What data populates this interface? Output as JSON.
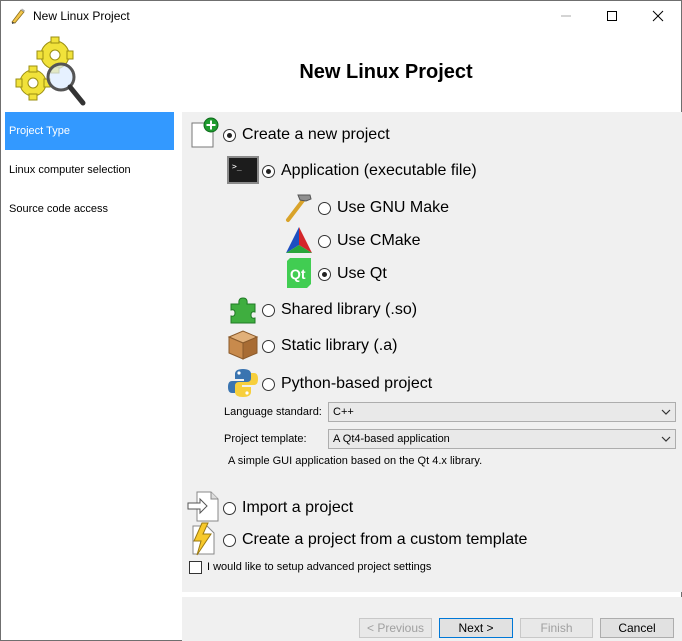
{
  "window": {
    "title": "New Linux Project"
  },
  "header": {
    "title": "New Linux Project"
  },
  "nav": {
    "items": [
      {
        "label": "Project Type"
      },
      {
        "label": "Linux computer selection"
      },
      {
        "label": "Source code access"
      }
    ]
  },
  "options": {
    "create_new": "Create a new project",
    "application": "Application (executable file)",
    "gnu_make": "Use GNU Make",
    "cmake": "Use CMake",
    "qt": "Use Qt",
    "shared_lib": "Shared library (.so)",
    "static_lib": "Static library (.a)",
    "python": "Python-based project",
    "import": "Import a project",
    "custom_template": "Create a project from a custom template"
  },
  "form": {
    "language_label": "Language standard:",
    "language_value": "C++",
    "template_label": "Project template:",
    "template_value": "A Qt4-based application",
    "template_desc": "A simple GUI application based on the Qt 4.x library."
  },
  "advanced": {
    "label": "I would like to setup advanced project settings"
  },
  "buttons": {
    "previous": "< Previous",
    "next": "Next >",
    "finish": "Finish",
    "cancel": "Cancel"
  },
  "icons": {
    "app": "pencil-icon",
    "logo": "gears-magnifier-icon",
    "new_project": "new-document-plus-icon",
    "console": "console-icon",
    "make": "hammer-icon",
    "cmake": "cmake-triangle-icon",
    "qt": "qt-icon",
    "shared": "puzzle-icon",
    "static": "box-icon",
    "python": "python-icon",
    "import": "import-arrow-icon",
    "template": "lightning-document-icon"
  },
  "colors": {
    "accent": "#3399ff",
    "panel": "#f0f0f0"
  }
}
